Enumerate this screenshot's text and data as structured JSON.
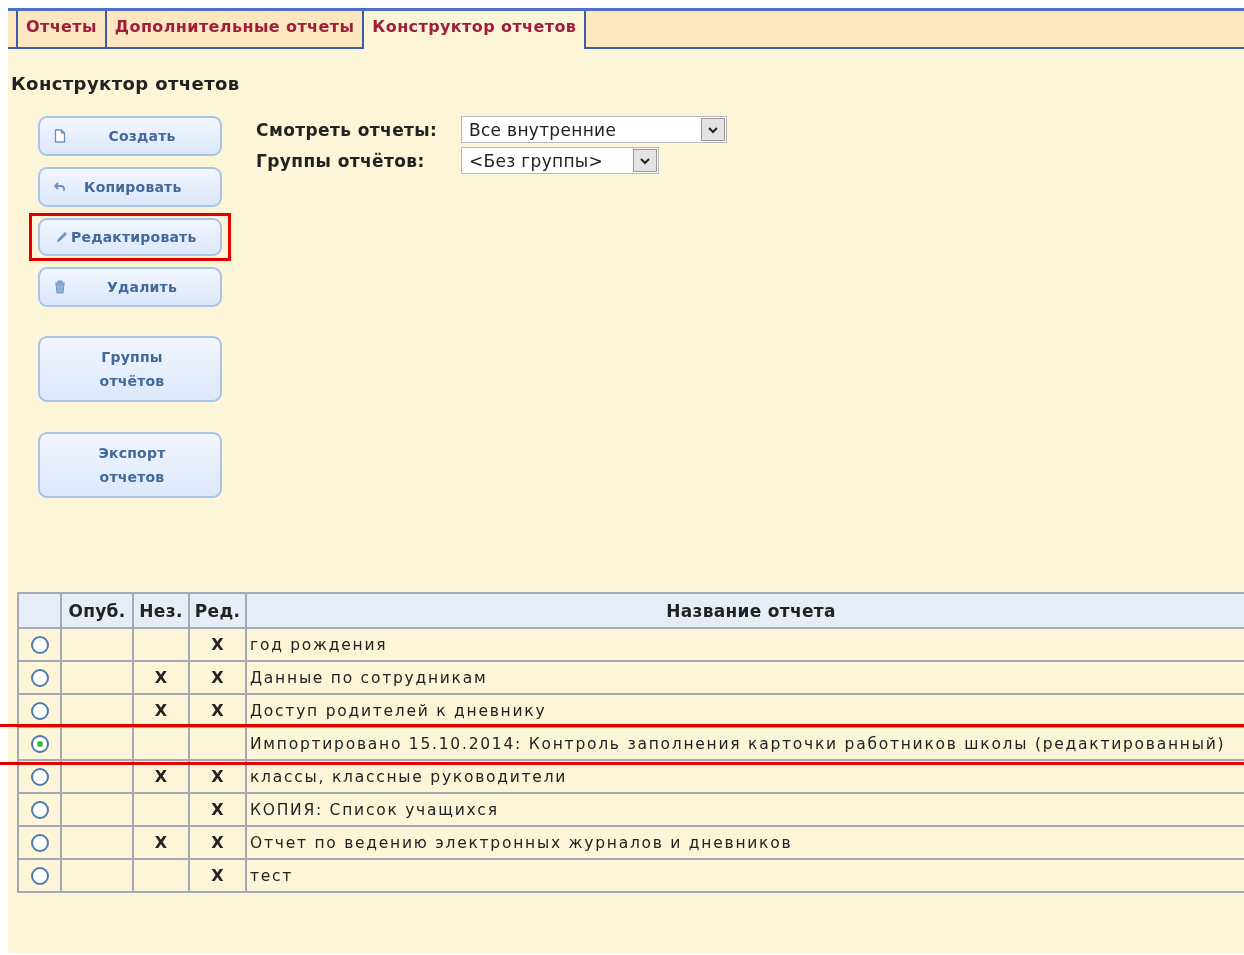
{
  "tabs": [
    {
      "label": "Отчеты",
      "selected": false
    },
    {
      "label": "Дополнительные отчеты",
      "selected": false
    },
    {
      "label": "Конструктор отчетов",
      "selected": true
    }
  ],
  "heading": "Конструктор отчетов",
  "buttons": [
    {
      "label": "Создать",
      "kind": "document",
      "highlighted": false
    },
    {
      "label": "Копировать",
      "kind": "undo",
      "highlighted": false
    },
    {
      "label": "Редактировать",
      "kind": "pencil",
      "highlighted": true
    },
    {
      "label": "Удалить",
      "kind": "trash",
      "highlighted": false
    }
  ],
  "big_buttons": [
    {
      "lines": [
        "Группы",
        "отчётов"
      ]
    },
    {
      "lines": [
        "Экспорт",
        "отчетов"
      ]
    }
  ],
  "filters": [
    {
      "label": "Смотреть отчеты:",
      "value": "Все внутренние"
    },
    {
      "label": "Группы отчётов:",
      "value": "<Без группы>"
    }
  ],
  "table": {
    "columns": [
      "Опуб.",
      "Нез.",
      "Ред.",
      "Название отчета"
    ],
    "rows": [
      {
        "selected": false,
        "published": "",
        "nez": "",
        "red": "X",
        "name": "год рождения",
        "highlighted": false
      },
      {
        "selected": false,
        "published": "",
        "nez": "X",
        "red": "X",
        "name": "Данные по сотрудникам",
        "highlighted": false
      },
      {
        "selected": false,
        "published": "",
        "nez": "X",
        "red": "X",
        "name": "Доступ родителей к дневнику",
        "highlighted": false
      },
      {
        "selected": true,
        "published": "",
        "nez": "",
        "red": "",
        "name": "Импортировано 15.10.2014: Контроль заполнения карточки работников школы (редактированный)",
        "highlighted": true
      },
      {
        "selected": false,
        "published": "",
        "nez": "X",
        "red": "X",
        "name": "классы, классные руководители",
        "highlighted": false
      },
      {
        "selected": false,
        "published": "",
        "nez": "",
        "red": "X",
        "name": "КОПИЯ: Список учащихся",
        "highlighted": false
      },
      {
        "selected": false,
        "published": "",
        "nez": "X",
        "red": "X",
        "name": "Отчет по ведению электронных журналов и дневников",
        "highlighted": false
      },
      {
        "selected": false,
        "published": "",
        "nez": "",
        "red": "X",
        "name": "тест",
        "highlighted": false
      }
    ]
  }
}
